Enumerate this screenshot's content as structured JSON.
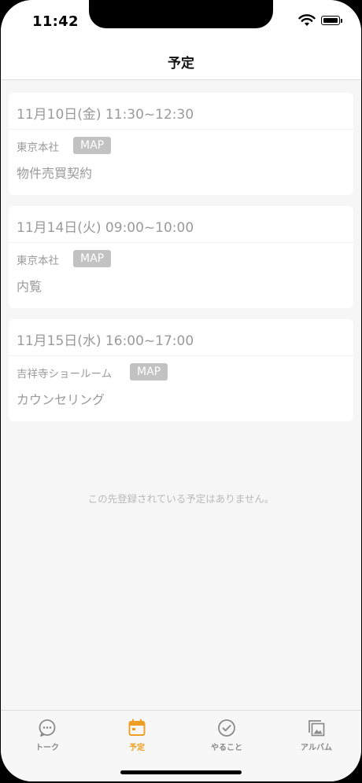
{
  "status_bar": {
    "time": "11:42"
  },
  "header": {
    "title": "予定"
  },
  "schedule": [
    {
      "date": "11月10日(金) 11:30~12:30",
      "location": "東京本社",
      "map_label": "MAP",
      "title": "物件売買契約"
    },
    {
      "date": "11月14日(火) 09:00~10:00",
      "location": "東京本社",
      "map_label": "MAP",
      "title": "内覧"
    },
    {
      "date": "11月15日(水) 16:00~17:00",
      "location": "吉祥寺ショールーム",
      "map_label": "MAP",
      "title": "カウンセリング"
    }
  ],
  "empty_message": "この先登録されている予定はありません。",
  "tab_bar": {
    "items": [
      {
        "label": "トーク",
        "icon": "chat-bubble-icon"
      },
      {
        "label": "予定",
        "icon": "calendar-icon",
        "active": true
      },
      {
        "label": "やること",
        "icon": "check-circle-icon"
      },
      {
        "label": "アルバム",
        "icon": "photo-album-icon"
      }
    ]
  },
  "colors": {
    "accent": "#ee9e23",
    "inactive_tab": "#8a8a8a",
    "map_badge": "#c2c2c2",
    "card_text": "#9a9a9a",
    "background": "#f6f6f6"
  }
}
